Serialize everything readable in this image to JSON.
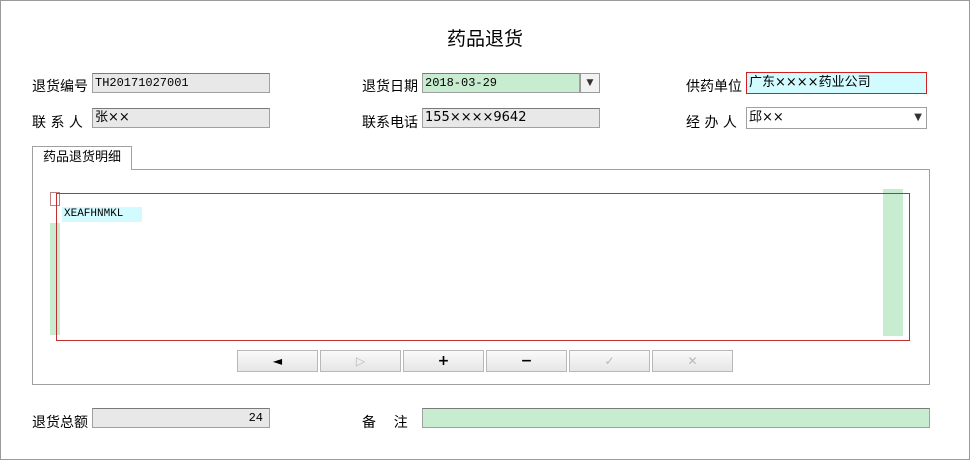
{
  "form": {
    "title": "药品退货",
    "return_no_label": "退货编号",
    "return_no": "TH20171027001",
    "return_date_label": "退货日期",
    "return_date": "2018-03-29",
    "supplier_label": "供药单位",
    "supplier": "广东××××药业公司",
    "contact_label": "联 系 人",
    "contact": "张××",
    "phone_label": "联系电话",
    "phone": "155××××9642",
    "handler_label": "经 办 人",
    "handler": "邱××",
    "total_label": "退货总额",
    "total": "24",
    "remark_label": "备    注",
    "remark": ""
  },
  "detail": {
    "tab_label": "药品退货明细",
    "grid_cell": "XEAFHNMKL"
  },
  "navigator": {
    "prior": "◄",
    "post": "▷",
    "insert": "+",
    "delete": "−",
    "confirm": "✓",
    "cancel": "✕"
  }
}
